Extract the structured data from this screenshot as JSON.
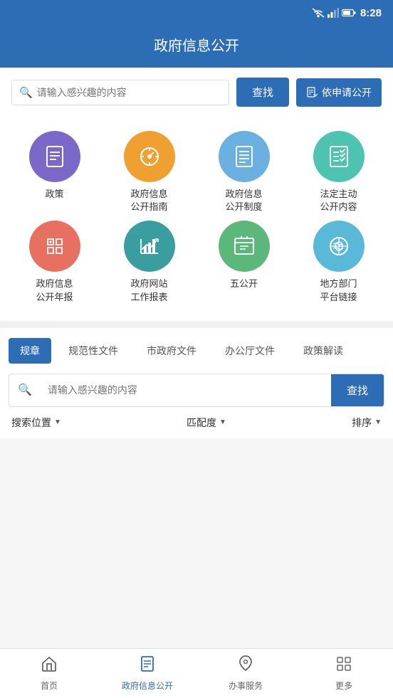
{
  "statusBar": {
    "time": "8:28"
  },
  "header": {
    "title": "政府信息公开"
  },
  "searchBar": {
    "placeholder": "请输入感兴趣的内容",
    "findLabel": "查找",
    "applyLabel": "依申请公开"
  },
  "iconGrid": {
    "rows": [
      [
        {
          "id": "policy",
          "label": "政策",
          "color": "bg-purple",
          "iconType": "doc-list"
        },
        {
          "id": "guide",
          "label": "政府信息\n公开指南",
          "color": "bg-orange",
          "iconType": "compass"
        },
        {
          "id": "system",
          "label": "政府信息\n公开制度",
          "color": "bg-blue-light",
          "iconType": "doc-lines"
        },
        {
          "id": "legal",
          "label": "法定主动\n公开内容",
          "color": "bg-teal",
          "iconType": "checklist"
        }
      ],
      [
        {
          "id": "annual",
          "label": "政府信息\n公开年报",
          "color": "bg-red",
          "iconType": "folder"
        },
        {
          "id": "work-report",
          "label": "政府网站\n工作报表",
          "color": "bg-dark-teal",
          "iconType": "chart"
        },
        {
          "id": "five-open",
          "label": "五公开",
          "color": "bg-green",
          "iconType": "calendar-check"
        },
        {
          "id": "local",
          "label": "地方部门\n平台链接",
          "color": "bg-sky",
          "iconType": "handshake"
        }
      ]
    ]
  },
  "filterSection": {
    "tabs": [
      {
        "id": "rules",
        "label": "规章",
        "active": true
      },
      {
        "id": "normative",
        "label": "规范性文件",
        "active": false
      },
      {
        "id": "city",
        "label": "市政府文件",
        "active": false
      },
      {
        "id": "office",
        "label": "办公厅文件",
        "active": false
      },
      {
        "id": "interpret",
        "label": "政策解读",
        "active": false
      }
    ],
    "searchPlaceholder": "请输入感兴趣的内容",
    "findLabel": "查找",
    "sortItems": [
      {
        "label": "搜索位置",
        "id": "search-pos"
      },
      {
        "label": "匹配度",
        "id": "match-level"
      },
      {
        "label": "排序",
        "id": "sort-order"
      }
    ]
  },
  "bottomNav": {
    "items": [
      {
        "id": "home",
        "label": "首页",
        "icon": "home",
        "active": false
      },
      {
        "id": "gov-info",
        "label": "政府信息公开",
        "icon": "doc",
        "active": true
      },
      {
        "id": "affairs",
        "label": "办事服务",
        "icon": "heart",
        "active": false
      },
      {
        "id": "more",
        "label": "更多",
        "icon": "grid",
        "active": false
      }
    ]
  }
}
